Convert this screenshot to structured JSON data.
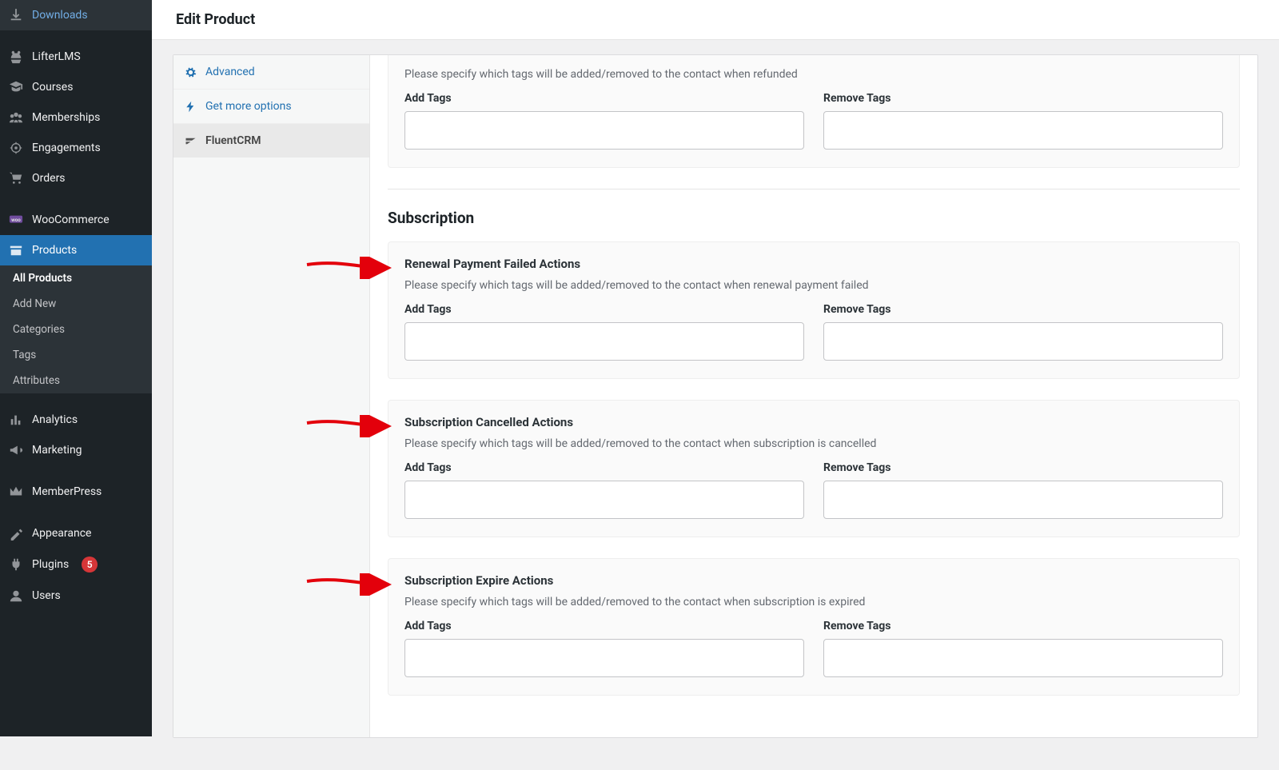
{
  "header": {
    "title": "Edit Product"
  },
  "sidebar": {
    "items": [
      {
        "label": "Downloads"
      },
      {
        "label": "LifterLMS"
      },
      {
        "label": "Courses"
      },
      {
        "label": "Memberships"
      },
      {
        "label": "Engagements"
      },
      {
        "label": "Orders"
      },
      {
        "label": "WooCommerce"
      },
      {
        "label": "Products",
        "current": true
      },
      {
        "label": "Analytics"
      },
      {
        "label": "Marketing"
      },
      {
        "label": "MemberPress"
      },
      {
        "label": "Appearance"
      },
      {
        "label": "Plugins",
        "badge": "5"
      },
      {
        "label": "Users"
      }
    ],
    "submenu_products": [
      {
        "label": "All Products",
        "current": true
      },
      {
        "label": "Add New"
      },
      {
        "label": "Categories"
      },
      {
        "label": "Tags"
      },
      {
        "label": "Attributes"
      }
    ]
  },
  "product_tabs": {
    "advanced": "Advanced",
    "get_more": "Get more options",
    "fluentcrm": "FluentCRM"
  },
  "labels": {
    "add_tags": "Add Tags",
    "remove_tags": "Remove Tags",
    "subscription_heading": "Subscription"
  },
  "blocks": {
    "refunded": {
      "desc": "Please specify which tags will be added/removed to the contact when refunded"
    },
    "renewal_failed": {
      "title": "Renewal Payment Failed Actions",
      "desc": "Please specify which tags will be added/removed to the contact when renewal payment failed"
    },
    "sub_cancelled": {
      "title": "Subscription Cancelled Actions",
      "desc": "Please specify which tags will be added/removed to the contact when subscription is cancelled"
    },
    "sub_expire": {
      "title": "Subscription Expire Actions",
      "desc": "Please specify which tags will be added/removed to the contact when subscription is expired"
    }
  }
}
